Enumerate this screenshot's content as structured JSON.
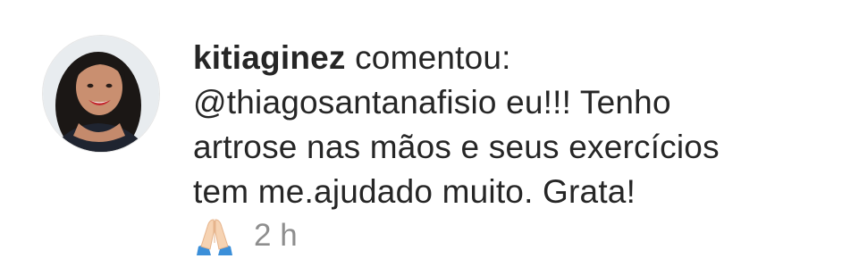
{
  "comment": {
    "username": "kitiaginez",
    "action": "comentou:",
    "mention": "@thiagosantanafisio",
    "text_line1_rest": "eu!!! Tenho",
    "text_line2": "artrose nas mãos e seus exercícios",
    "text_line3": "tem me.ajudado muito. Grata!",
    "reaction_icon": "folded-hands-emoji",
    "timestamp": "2 h"
  },
  "colors": {
    "text": "#262626",
    "timestamp": "#8e8e8e",
    "background": "#ffffff"
  }
}
